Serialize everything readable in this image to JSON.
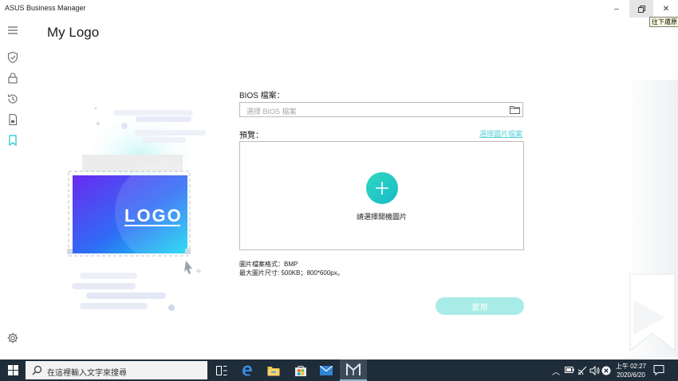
{
  "window": {
    "app_title": "ASUS Business Manager",
    "minimize_glyph": "–",
    "close_glyph": "✕",
    "restore_tooltip": "往下還原"
  },
  "sidebar": {
    "items": [
      {
        "icon": "menu-icon"
      },
      {
        "icon": "shield-check-icon"
      },
      {
        "icon": "lock-icon"
      },
      {
        "icon": "history-icon"
      },
      {
        "icon": "document-icon"
      },
      {
        "icon": "bookmark-icon",
        "active": true
      },
      {
        "icon": "gear-icon"
      }
    ]
  },
  "page": {
    "title": "My Logo"
  },
  "illustration": {
    "logo_text": "LOGO"
  },
  "form": {
    "bios_label": "BIOS 檔案：",
    "bios_placeholder": "選擇 BIOS 檔案",
    "preview_label": "預覽：",
    "choose_image_link": "選擇圖片檔案",
    "preview_hint": "請選擇開機圖片",
    "format_line": "圖片檔案格式：BMP",
    "size_line": "最大圖片尺寸: 500KB；800*600px。",
    "apply_label": "套用"
  },
  "taskbar": {
    "search_placeholder": "在這裡輸入文字來搜尋",
    "time": "上午 02:27",
    "date": "2020/6/20",
    "pinned": [
      "task-view-icon",
      "edge-icon",
      "file-explorer-icon",
      "store-icon",
      "mail-icon",
      "asus-business-manager-icon"
    ]
  },
  "colors": {
    "accent": "#1fc6c6",
    "apply_disabled": "#a9ece7",
    "link": "#5ad0d8",
    "taskbar_bg": "#1f2d3a"
  }
}
